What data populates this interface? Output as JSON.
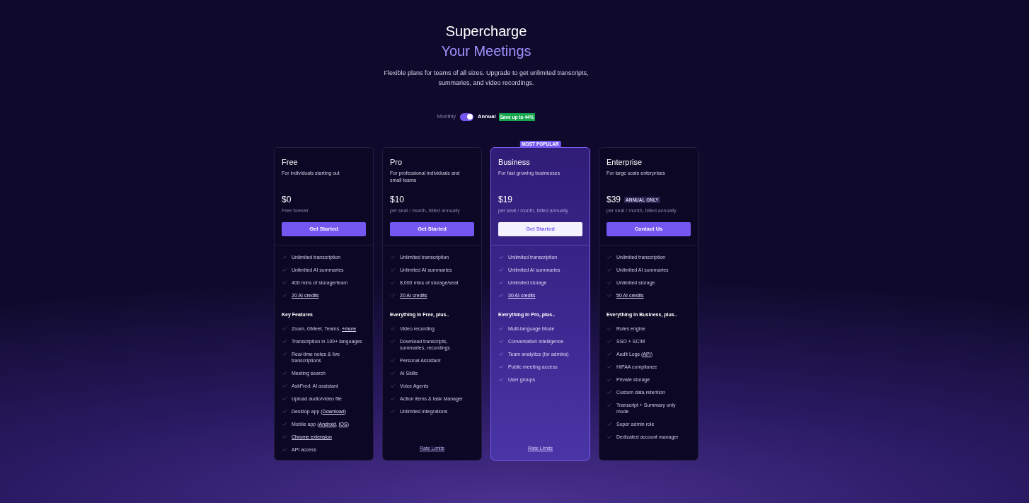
{
  "header": {
    "title": "Supercharge",
    "highlight": "Your Meetings",
    "description": "Flexible plans for teams of all sizes. Upgrade to get unlimited transcripts, summaries, and video recordings."
  },
  "billing": {
    "left_label": "Monthly",
    "right_label": "Annual",
    "on": true,
    "badge": "Save up to 44%"
  },
  "plans": [
    {
      "name": "Free",
      "subtitle": "For individuals starting out",
      "price": "$0",
      "price_note": "Free forever",
      "button": "Get Started",
      "highlighted": false,
      "features": [
        {
          "segments": [
            {
              "text": "Unlimited transcription",
              "link": false
            }
          ]
        },
        {
          "segments": [
            {
              "text": "Unlimited AI summaries",
              "link": false
            }
          ]
        },
        {
          "segments": [
            {
              "text": "400 mins of storage/team",
              "link": false
            }
          ]
        },
        {
          "segments": [
            {
              "text": "20 AI credits",
              "link": true
            }
          ]
        }
      ],
      "section_title": "Key Features",
      "extra_features": [
        {
          "segments": [
            {
              "text": "Zoom, GMeet, Teams, ",
              "link": false
            },
            {
              "text": "+more",
              "link": true
            }
          ]
        },
        {
          "segments": [
            {
              "text": "Transcription in 100+ languages",
              "link": false
            }
          ]
        },
        {
          "segments": [
            {
              "text": "Real-time notes & live transcriptions",
              "link": false
            }
          ]
        },
        {
          "segments": [
            {
              "text": "Meeting search",
              "link": false
            }
          ]
        },
        {
          "segments": [
            {
              "text": "AskFred: AI assistant",
              "link": false
            }
          ]
        },
        {
          "segments": [
            {
              "text": "Upload audio/video file",
              "link": false
            }
          ]
        },
        {
          "segments": [
            {
              "text": "Desktop app (",
              "link": false
            },
            {
              "text": "Download",
              "link": true
            },
            {
              "text": ")",
              "link": false
            }
          ]
        },
        {
          "segments": [
            {
              "text": "Mobile app (",
              "link": false
            },
            {
              "text": "Android",
              "link": true
            },
            {
              "text": ", ",
              "link": false
            },
            {
              "text": "IOS",
              "link": true
            },
            {
              "text": ")",
              "link": false
            }
          ]
        },
        {
          "segments": [
            {
              "text": "Chrome extension",
              "link": true
            }
          ]
        },
        {
          "segments": [
            {
              "text": "API access",
              "link": false
            }
          ]
        }
      ]
    },
    {
      "name": "Pro",
      "subtitle": "For professional individuals and small teams",
      "price": "$10",
      "price_note": "per seat / month, billed annually",
      "button": "Get Started",
      "highlighted": false,
      "features": [
        {
          "segments": [
            {
              "text": "Unlimited transcription",
              "link": false
            }
          ]
        },
        {
          "segments": [
            {
              "text": "Unlimited AI summaries",
              "link": false
            }
          ]
        },
        {
          "segments": [
            {
              "text": "8,000 mins of storage/seat",
              "link": false
            }
          ]
        },
        {
          "segments": [
            {
              "text": "20 AI credits",
              "link": true
            }
          ]
        }
      ],
      "section_title": "Everything in Free, plus..",
      "extra_features": [
        {
          "segments": [
            {
              "text": "Video recording",
              "link": false
            }
          ]
        },
        {
          "segments": [
            {
              "text": "Download transcripts, summaries, recordings",
              "link": false
            }
          ]
        },
        {
          "segments": [
            {
              "text": "Personal Assistant",
              "link": false
            }
          ]
        },
        {
          "segments": [
            {
              "text": "AI Skills",
              "link": false
            }
          ]
        },
        {
          "segments": [
            {
              "text": "Voice Agents",
              "link": false
            }
          ]
        },
        {
          "segments": [
            {
              "text": "Action items & task Manager",
              "link": false
            }
          ]
        },
        {
          "segments": [
            {
              "text": "Unlimited integrations",
              "link": false
            }
          ]
        }
      ],
      "footer_link": "Rate Limits"
    },
    {
      "name": "Business",
      "ribbon": "MOST POPULAR",
      "subtitle": "For fast growing businesses",
      "price": "$19",
      "price_note": "per seat / month, billed annually",
      "button": "Get Started",
      "highlighted": true,
      "features": [
        {
          "segments": [
            {
              "text": "Unlimited transcription",
              "link": false
            }
          ]
        },
        {
          "segments": [
            {
              "text": "Unlimited AI summaries",
              "link": false
            }
          ]
        },
        {
          "segments": [
            {
              "text": "Unlimited storage",
              "link": false
            }
          ]
        },
        {
          "segments": [
            {
              "text": "30 AI credits",
              "link": true
            }
          ]
        }
      ],
      "section_title": "Everything in Pro, plus..",
      "extra_features": [
        {
          "segments": [
            {
              "text": "Multi-language Mode",
              "link": false
            }
          ]
        },
        {
          "segments": [
            {
              "text": "Conversation intelligence",
              "link": false
            }
          ]
        },
        {
          "segments": [
            {
              "text": "Team analytics (for admins)",
              "link": false
            }
          ]
        },
        {
          "segments": [
            {
              "text": "Public meeting access",
              "link": false
            }
          ]
        },
        {
          "segments": [
            {
              "text": "User groups",
              "link": false
            }
          ]
        }
      ],
      "footer_link": "Rate Limits"
    },
    {
      "name": "Enterprise",
      "subtitle": "For large scale enterprises",
      "price": "$39",
      "price_badge": "ANNUAL ONLY",
      "price_note": "per seat / month, billed annually",
      "button": "Contact Us",
      "highlighted": false,
      "features": [
        {
          "segments": [
            {
              "text": "Unlimited transcription",
              "link": false
            }
          ]
        },
        {
          "segments": [
            {
              "text": "Unlimited AI summaries",
              "link": false
            }
          ]
        },
        {
          "segments": [
            {
              "text": "Unlimited storage",
              "link": false
            }
          ]
        },
        {
          "segments": [
            {
              "text": "50 AI credits",
              "link": true
            }
          ]
        }
      ],
      "section_title": "Everything in Business, plus..",
      "extra_features": [
        {
          "segments": [
            {
              "text": "Rules engine",
              "link": false
            }
          ]
        },
        {
          "segments": [
            {
              "text": "SSO + SCIM",
              "link": false
            }
          ]
        },
        {
          "segments": [
            {
              "text": "Audit Logs (",
              "link": false
            },
            {
              "text": "API",
              "link": true
            },
            {
              "text": ")",
              "link": false
            }
          ]
        },
        {
          "segments": [
            {
              "text": "HIPAA compliance",
              "link": false
            }
          ]
        },
        {
          "segments": [
            {
              "text": "Private storage",
              "link": false
            }
          ]
        },
        {
          "segments": [
            {
              "text": "Custom data retention",
              "link": false
            }
          ]
        },
        {
          "segments": [
            {
              "text": "Transcript + Summary only mode",
              "link": false
            }
          ]
        },
        {
          "segments": [
            {
              "text": "Super admin role",
              "link": false
            }
          ]
        },
        {
          "segments": [
            {
              "text": "Dedicated account manager",
              "link": false
            }
          ]
        }
      ]
    }
  ]
}
